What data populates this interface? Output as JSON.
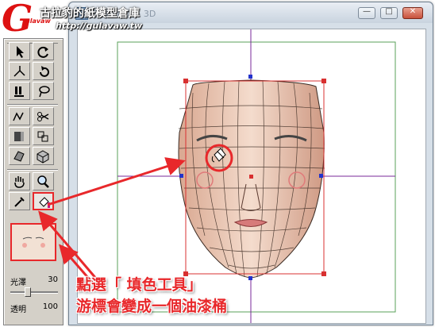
{
  "logo": {
    "mark": "G",
    "mark_sub": "ulavaw",
    "site_name": "古拉豹的紙模型倉庫",
    "url": "http://gulavaw.tw"
  },
  "window": {
    "title": "名稱 - 紙型 - 3D",
    "min_glyph": "—",
    "max_glyph": "□",
    "close_glyph": "✕"
  },
  "toolbox": {
    "tools": [
      {
        "name": "select-arrow-icon"
      },
      {
        "name": "rotate-icon"
      },
      {
        "name": "edge-select-icon"
      },
      {
        "name": "rotate-part-icon"
      },
      {
        "name": "flip-icon"
      },
      {
        "name": "lasso-icon"
      },
      {
        "name": "path-icon"
      },
      {
        "name": "cut-edge-icon"
      },
      {
        "name": "unfold-icon"
      },
      {
        "name": "join-icon"
      },
      {
        "name": "face-icon"
      },
      {
        "name": "cube-icon"
      },
      {
        "name": "hand-pan-icon"
      },
      {
        "name": "zoom-icon"
      },
      {
        "name": "eyedropper-icon"
      },
      {
        "name": "paint-bucket-icon"
      }
    ],
    "gloss_label": "光澤",
    "gloss_value": "30",
    "gloss_level": 0.3,
    "opacity_label": "透明",
    "opacity_value": "100",
    "opacity_level": 1.0
  },
  "annotation": {
    "line1": "點選「 填色工具」",
    "line2": "游標會變成一個油漆桶",
    "color": "#e8282b"
  },
  "colors": {
    "skin": "#e9c8b4",
    "selection": "#d83030",
    "axis": "#7a2a9a",
    "guide": "#5aa05a"
  }
}
